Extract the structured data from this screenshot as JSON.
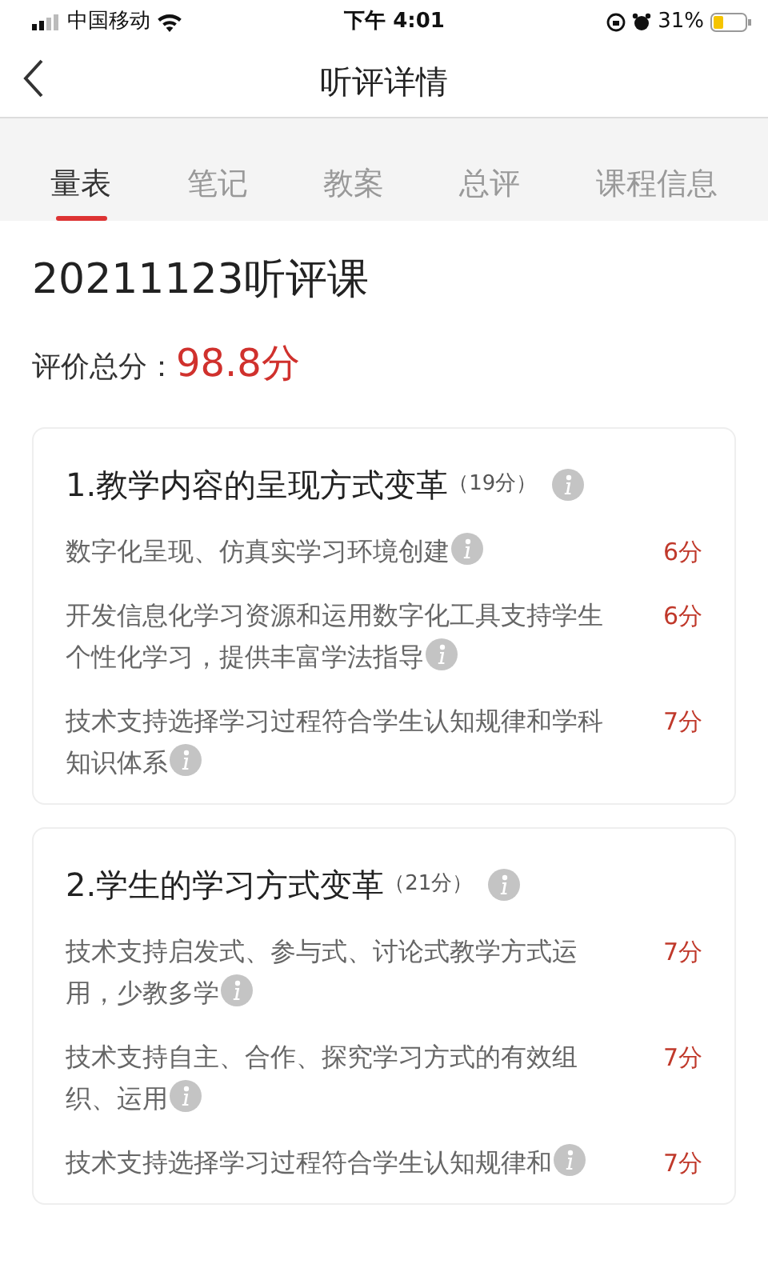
{
  "status_bar": {
    "carrier": "中国移动",
    "time": "下午 4:01",
    "battery": "31%"
  },
  "header": {
    "title": "听评详情"
  },
  "tabs": [
    {
      "label": "量表",
      "selected": true
    },
    {
      "label": "笔记",
      "selected": false
    },
    {
      "label": "教案",
      "selected": false
    },
    {
      "label": "总评",
      "selected": false
    },
    {
      "label": "课程信息",
      "selected": false
    }
  ],
  "lesson_title": "20211123听评课",
  "total": {
    "label": "评价总分：",
    "score": "98.8分"
  },
  "sections": [
    {
      "title": "1.教学内容的呈现方式变革",
      "points": "（19分）",
      "items": [
        {
          "text": "数字化呈现、仿真实学习环境创建",
          "score": "6分"
        },
        {
          "text": "开发信息化学习资源和运用数字化工具支持学生个性化学习，提供丰富学法指导",
          "score": "6分"
        },
        {
          "text": "技术支持选择学习过程符合学生认知规律和学科知识体系",
          "score": "7分"
        }
      ]
    },
    {
      "title": "2.学生的学习方式变革",
      "points": "（21分）",
      "items": [
        {
          "text": "技术支持启发式、参与式、讨论式教学方式运用，少教多学",
          "score": "7分"
        },
        {
          "text": "技术支持自主、合作、探究学习方式的有效组织、运用",
          "score": "7分"
        },
        {
          "text": "技术支持选择学习过程符合学生认知规律和",
          "score": "7分"
        }
      ]
    }
  ]
}
